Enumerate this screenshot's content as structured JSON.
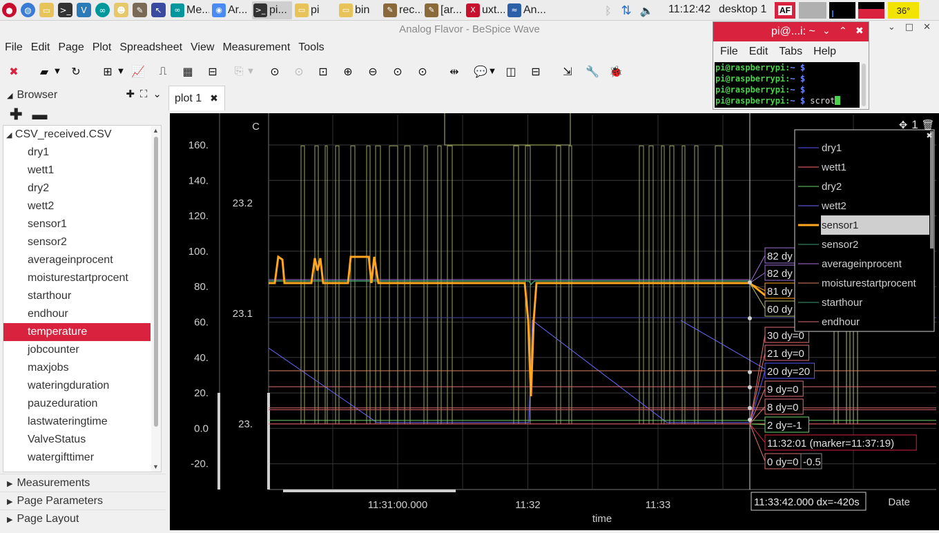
{
  "taskbar": {
    "tasks": [
      {
        "label": "Me...",
        "icon": "arduino-icon"
      },
      {
        "label": "Ar...",
        "icon": "chromium-icon"
      },
      {
        "label": "pi...",
        "icon": "terminal-icon"
      },
      {
        "label": "pi",
        "icon": "folder-icon"
      },
      {
        "label": "bin",
        "icon": "folder-icon"
      },
      {
        "label": "rec...",
        "icon": "text-editor-icon"
      },
      {
        "label": "[ar...",
        "icon": "text-editor-icon"
      },
      {
        "label": "uxt...",
        "icon": "x-terminal-icon"
      },
      {
        "label": "An...",
        "icon": "bespice-icon"
      }
    ],
    "clock": "11:12:42",
    "desktop": "desktop 1",
    "af_badge": "AF",
    "cpu_temp": "36°"
  },
  "window": {
    "title": "Analog Flavor - BeSpice Wave",
    "menu": [
      "File",
      "Edit",
      "Page",
      "Plot",
      "Spreadsheet",
      "View",
      "Measurement",
      "Tools"
    ]
  },
  "browser": {
    "title": "Browser",
    "file": "CSV_received.CSV",
    "items": [
      "dry1",
      "wett1",
      "dry2",
      "wett2",
      "sensor1",
      "sensor2",
      "averageinprocent",
      "moisturestartprocent",
      "starthour",
      "endhour",
      "temperature",
      "jobcounter",
      "maxjobs",
      "wateringduration",
      "pauzeduration",
      "lastwateringtime",
      "ValveStatus",
      "watergifttimer"
    ],
    "selected": "temperature",
    "sections": [
      "Measurements",
      "Page Parameters",
      "Page Layout"
    ]
  },
  "plot": {
    "tab_label": "plot 1",
    "corner_count": "1",
    "axis_unit": "C",
    "left_ticks": [
      "160.",
      "140.",
      "120.",
      "100.",
      "80.",
      "60.",
      "40.",
      "20.",
      "0.0",
      "-20."
    ],
    "right_ticks": [
      "23.2",
      "23.1",
      "23."
    ],
    "x_ticks": [
      "11:31:00.000",
      "11:32",
      "11:33"
    ],
    "xlabel": "time",
    "date_label": "Date",
    "legend": [
      {
        "name": "dry1",
        "color": "#5a5aff"
      },
      {
        "name": "wett1",
        "color": "#ff6b6b"
      },
      {
        "name": "dry2",
        "color": "#6bd36b"
      },
      {
        "name": "wett2",
        "color": "#6a6aff"
      },
      {
        "name": "sensor1",
        "color": "#ffa520"
      },
      {
        "name": "sensor2",
        "color": "#3fa06a"
      },
      {
        "name": "averageinprocent",
        "color": "#b06be0"
      },
      {
        "name": "moisturestartprocent",
        "color": "#e08060"
      },
      {
        "name": "starthour",
        "color": "#3fa06a"
      },
      {
        "name": "endhour",
        "color": "#e07070"
      }
    ],
    "legend_selected": "sensor1",
    "annotations": [
      {
        "text": "82 dy",
        "color": "#a070d8"
      },
      {
        "text": "82 dy",
        "color": "#a070d8"
      },
      {
        "text": "81 dy",
        "color": "#ffa520"
      },
      {
        "text": "60 dy",
        "color": "#b8c070"
      },
      {
        "text": "30 dy=0",
        "color": "#e07070"
      },
      {
        "text": "21 dy=0",
        "color": "#e07070"
      },
      {
        "text": "20 dy=20",
        "color": "#5a5aff"
      },
      {
        "text": "9 dy=0",
        "color": "#e07070"
      },
      {
        "text": "8 dy=0",
        "color": "#e07070"
      },
      {
        "text": "2 dy=-1",
        "color": "#6bd36b"
      },
      {
        "text": "11:32:01 (marker=11:37:19)",
        "color": "#d9223d"
      },
      {
        "text": "0 dy=0",
        "color": "#e07070"
      },
      {
        "text": "-0.5",
        "color": "#888888"
      }
    ],
    "marker_label": "11:33:42.000 dx=-420s"
  },
  "terminal": {
    "title": "pi@...i: ~",
    "menu": [
      "File",
      "Edit",
      "Tabs",
      "Help"
    ],
    "prompt_user": "pi@raspberrypi",
    "prompt_path": "~",
    "last_command": "scrot"
  },
  "chart_data": {
    "type": "line",
    "x": [
      "11:31:00",
      "11:32",
      "11:33"
    ],
    "xlabel": "time",
    "ylabel": "",
    "ylim": [
      -20,
      170
    ],
    "series": [
      {
        "name": "dry1",
        "values": []
      },
      {
        "name": "wett1",
        "values": [
          0,
          0,
          0
        ]
      },
      {
        "name": "dry2",
        "values": [
          82,
          82,
          82
        ]
      },
      {
        "name": "wett2",
        "values": [
          45,
          0,
          0
        ]
      },
      {
        "name": "sensor1",
        "values": [
          80,
          80,
          80
        ]
      },
      {
        "name": "sensor2",
        "values": [
          82,
          82,
          82
        ]
      },
      {
        "name": "averageinprocent",
        "values": [
          82,
          82,
          82
        ]
      },
      {
        "name": "moisturestartprocent",
        "values": [
          30,
          30,
          30
        ]
      },
      {
        "name": "starthour",
        "values": [
          9,
          9,
          9
        ]
      },
      {
        "name": "endhour",
        "values": [
          21,
          21,
          21
        ]
      }
    ],
    "grid": true,
    "legend": "top-right"
  }
}
